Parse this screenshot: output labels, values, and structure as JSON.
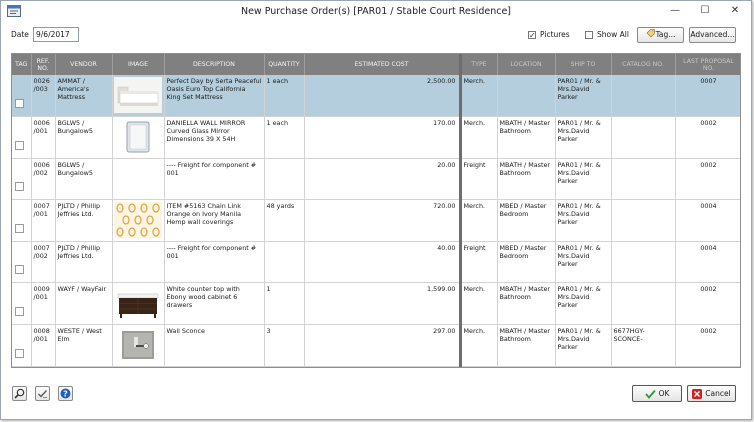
{
  "window": {
    "title": "New Purchase Order(s) [PAR01 / Stable Court Residence]",
    "minimize_glyph": "—",
    "maximize_glyph": "☐",
    "close_glyph": "✕"
  },
  "toolbar": {
    "date_label": "Date",
    "date_value": "9/6/2017",
    "pictures_label": "Pictures",
    "pictures_checked": true,
    "show_all_label": "Show All",
    "show_all_checked": false,
    "tag_button": "Tag...",
    "advanced_button": "Advanced..."
  },
  "table": {
    "columns": [
      "TAG",
      "REF. NO.",
      "VENDOR",
      "IMAGE",
      "DESCRIPTION",
      "QUANTITY",
      "ESTIMATED COST",
      "TYPE",
      "LOCATION",
      "SHIP TO",
      "CATALOG NO.",
      "LAST PROPOSAL NO."
    ],
    "rows": [
      {
        "ref": "0026 /003",
        "vendor": "AMMAT / America's Mattress",
        "image": "mattress",
        "description": "Perfect Day by Serta Peaceful Oasis Euro Top California King Set Mattress",
        "quantity": "1 each",
        "cost": "2,500.00",
        "type": "Merch.",
        "location": "",
        "ship_to": "PAR01 / Mr. & Mrs.David Parker",
        "catalog": "",
        "proposal": "0007"
      },
      {
        "ref": "0006 /001",
        "vendor": "BGLW5 / Bungalow5",
        "image": "mirror",
        "description": "DANIELLA WALL MIRROR Curved Glass Mirror Dimensions 39 X 54H",
        "quantity": "1 each",
        "cost": "170.00",
        "type": "Merch.",
        "location": "MBATH / Master Bathroom",
        "ship_to": "PAR01 / Mr. & Mrs.David Parker",
        "catalog": "",
        "proposal": "0002"
      },
      {
        "ref": "0006 /002",
        "vendor": "BGLW5 / Bungalow5",
        "image": "",
        "description": "---- Freight for component # 001",
        "quantity": "",
        "cost": "20.00",
        "type": "Freight",
        "location": "MBATH / Master Bathroom",
        "ship_to": "PAR01 / Mr. & Mrs.David Parker",
        "catalog": "",
        "proposal": "0002"
      },
      {
        "ref": "0007 /001",
        "vendor": "PJLTD / Phillip Jeffries Ltd.",
        "image": "wallcovering",
        "description": "ITEM #5163 Chain Link Orange on Ivory Manila Hemp wall coverings",
        "quantity": "48 yards",
        "cost": "720.00",
        "type": "Merch.",
        "location": "MBED / Master Bedroom",
        "ship_to": "PAR01 / Mr. & Mrs.David Parker",
        "catalog": "",
        "proposal": "0004"
      },
      {
        "ref": "0007 /002",
        "vendor": "PJLTD / Phillip Jeffries Ltd.",
        "image": "",
        "description": "---- Freight for component # 001",
        "quantity": "",
        "cost": "40.00",
        "type": "Freight",
        "location": "MBED / Master Bedroom",
        "ship_to": "PAR01 / Mr. & Mrs.David Parker",
        "catalog": "",
        "proposal": "0004"
      },
      {
        "ref": "0009 /001",
        "vendor": "WAYF / WayFair",
        "image": "vanity",
        "description": "White counter top with Ebony wood cabinet 6 drawers",
        "quantity": "1",
        "cost": "1,599.00",
        "type": "Merch.",
        "location": "MBATH / Master Bathroom",
        "ship_to": "PAR01 / Mr. & Mrs.David Parker",
        "catalog": "",
        "proposal": "0002"
      },
      {
        "ref": "0008 /001",
        "vendor": "WESTE / West Elm",
        "image": "sconce",
        "description": "Wall Sconce",
        "quantity": "3",
        "cost": "297.00",
        "type": "Merch.",
        "location": "MBATH / Master Bathroom",
        "ship_to": "PAR01 / Mr. & Mrs.David Parker",
        "catalog": "6677HGY-SCONCE-",
        "proposal": "0002"
      }
    ],
    "selected_row": 0
  },
  "footer": {
    "ok_label": "OK",
    "cancel_label": "Cancel"
  },
  "colors": {
    "selected_row": "#b4cedd",
    "header_bg": "#808080",
    "ok_check": "#2e9b2e",
    "cancel_x": "#cc2222",
    "help_blue": "#1f5fbf"
  }
}
